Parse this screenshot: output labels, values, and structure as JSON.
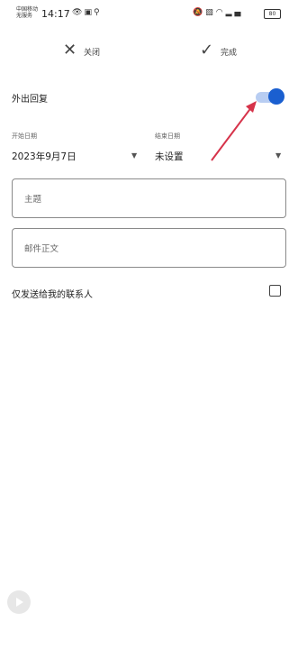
{
  "status_bar": {
    "carrier_line1": "中国移动",
    "carrier_line2": "无服务",
    "time": "14:17",
    "battery": "80"
  },
  "toolbar": {
    "close_icon": "close-icon",
    "close_label": "关闭",
    "done_icon": "checkmark-icon",
    "done_label": "完成"
  },
  "auto_reply": {
    "label": "外出回复",
    "enabled": true,
    "accent_color": "#1a5fd0"
  },
  "dates": {
    "start_label": "开始日期",
    "start_value": "2023年9月7日",
    "end_label": "结束日期",
    "end_value": "未设置"
  },
  "subject": {
    "placeholder": "主题"
  },
  "body_field": {
    "placeholder": "邮件正文"
  },
  "contacts_only": {
    "label": "仅发送给我的联系人",
    "checked": false
  },
  "annotation": {
    "arrow_color": "#d6334a"
  }
}
